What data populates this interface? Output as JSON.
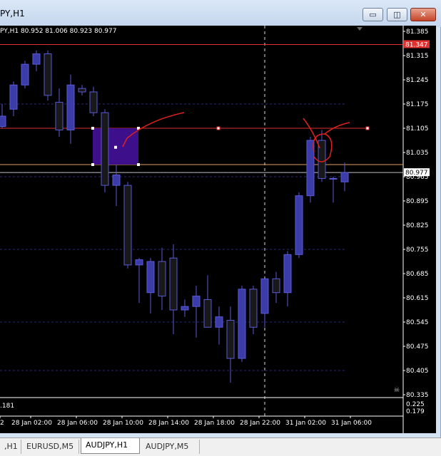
{
  "window": {
    "title": "PY,H1",
    "buttons": [
      "minimize",
      "restore",
      "close"
    ],
    "glyphs": {
      "minimize": "▭",
      "restore": "◫",
      "close": "✕"
    }
  },
  "chart": {
    "info": "PY,H1  80.952 81.006 80.923 80.977",
    "price_labels": [
      "81.385",
      "81.347",
      "81.315",
      "81.245",
      "81.175",
      "81.105",
      "81.035",
      "80.977",
      "80.965",
      "80.895",
      "80.825",
      "80.755",
      "80.685",
      "80.615",
      "80.545",
      "80.475",
      "80.405",
      "80.335"
    ],
    "current_price": "80.977",
    "red_level": "81.347",
    "indicator_value": ".181",
    "indicator_scale": [
      "0.225",
      "0.179"
    ],
    "time_labels": [
      "2",
      "28 Jan 02:00",
      "28 Jan 06:00",
      "28 Jan 10:00",
      "28 Jan 14:00",
      "28 Jan 18:00",
      "28 Jan 22:00",
      "31 Jan 02:00",
      "31 Jan 06:00"
    ],
    "colors": {
      "bull": "#3c3ca8",
      "bear": "#181818",
      "wick": "#5a5ad8",
      "grid": "#2a2a6a",
      "hline": "#e03030",
      "price_line": "#c0c0c0",
      "rect": "#3d0f8a",
      "drawing": "#e02020"
    }
  },
  "chart_data": {
    "type": "candlestick",
    "symbol": "AUDJPY",
    "timeframe": "H1",
    "ylim": [
      80.335,
      81.385
    ],
    "candles": [
      {
        "o": 81.11,
        "h": 81.175,
        "l": 81.105,
        "c": 81.14
      },
      {
        "o": 81.16,
        "h": 81.24,
        "l": 81.14,
        "c": 81.23
      },
      {
        "o": 81.23,
        "h": 81.3,
        "l": 81.22,
        "c": 81.29
      },
      {
        "o": 81.29,
        "h": 81.33,
        "l": 81.27,
        "c": 81.32
      },
      {
        "o": 81.32,
        "h": 81.33,
        "l": 81.185,
        "c": 81.2
      },
      {
        "o": 81.18,
        "h": 81.22,
        "l": 81.08,
        "c": 81.1
      },
      {
        "o": 81.1,
        "h": 81.26,
        "l": 81.06,
        "c": 81.23
      },
      {
        "o": 81.22,
        "h": 81.23,
        "l": 81.2,
        "c": 81.21
      },
      {
        "o": 81.21,
        "h": 81.225,
        "l": 81.14,
        "c": 81.15
      },
      {
        "o": 81.15,
        "h": 81.16,
        "l": 80.92,
        "c": 80.94
      },
      {
        "o": 80.94,
        "h": 81.0,
        "l": 80.88,
        "c": 80.97
      },
      {
        "o": 80.94,
        "h": 80.95,
        "l": 80.7,
        "c": 80.71
      },
      {
        "o": 80.71,
        "h": 80.73,
        "l": 80.6,
        "c": 80.725
      },
      {
        "o": 80.63,
        "h": 80.73,
        "l": 80.57,
        "c": 80.72
      },
      {
        "o": 80.72,
        "h": 80.76,
        "l": 80.58,
        "c": 80.62
      },
      {
        "o": 80.73,
        "h": 80.77,
        "l": 80.51,
        "c": 80.58
      },
      {
        "o": 80.58,
        "h": 80.61,
        "l": 80.56,
        "c": 80.59
      },
      {
        "o": 80.59,
        "h": 80.65,
        "l": 80.5,
        "c": 80.62
      },
      {
        "o": 80.61,
        "h": 80.68,
        "l": 80.54,
        "c": 80.53
      },
      {
        "o": 80.53,
        "h": 80.59,
        "l": 80.48,
        "c": 80.56
      },
      {
        "o": 80.55,
        "h": 80.59,
        "l": 80.37,
        "c": 80.44
      },
      {
        "o": 80.44,
        "h": 80.65,
        "l": 80.43,
        "c": 80.64
      },
      {
        "o": 80.64,
        "h": 80.65,
        "l": 80.51,
        "c": 80.53
      },
      {
        "o": 80.57,
        "h": 80.67,
        "l": 80.53,
        "c": 80.67
      },
      {
        "o": 80.67,
        "h": 80.69,
        "l": 80.6,
        "c": 80.63
      },
      {
        "o": 80.63,
        "h": 80.75,
        "l": 80.59,
        "c": 80.74
      },
      {
        "o": 80.74,
        "h": 80.92,
        "l": 80.73,
        "c": 80.91
      },
      {
        "o": 80.91,
        "h": 81.08,
        "l": 80.89,
        "c": 81.07
      },
      {
        "o": 81.07,
        "h": 81.1,
        "l": 80.95,
        "c": 80.96
      },
      {
        "o": 80.96,
        "h": 80.965,
        "l": 80.89,
        "c": 80.96
      },
      {
        "o": 80.95,
        "h": 81.006,
        "l": 80.923,
        "c": 80.977
      }
    ],
    "horizontal_lines": [
      81.347,
      81.105,
      80.977
    ],
    "rectangle": {
      "top": 81.105,
      "bottom": 81.0
    }
  },
  "tabs": [
    {
      "label": ",H1",
      "active": false
    },
    {
      "label": "EURUSD,M5",
      "active": false
    },
    {
      "label": "AUDJPY,H1",
      "active": true
    },
    {
      "label": "AUDJPY,M5",
      "active": false
    }
  ]
}
